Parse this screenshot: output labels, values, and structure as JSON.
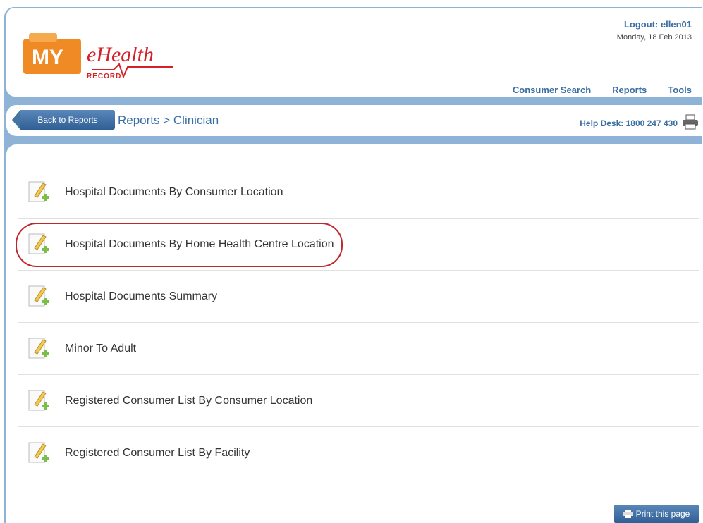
{
  "colors": {
    "accent": "#3a6fa3",
    "frame": "#8fb3d6",
    "highlight": "#c0282d",
    "logo_orange": "#f08a24",
    "logo_red": "#d42027"
  },
  "logo": {
    "my": "MY",
    "ehealth": "eHealth",
    "record": "RECORD"
  },
  "header": {
    "logout": "Logout: ellen01",
    "date": "Monday, 18 Feb 2013",
    "nav": [
      "Consumer Search",
      "Reports",
      "Tools"
    ]
  },
  "subbar": {
    "back_label": "Back to Reports",
    "breadcrumb": "Reports > Clinician",
    "helpdesk": "Help Desk: 1800 247 430",
    "print_icon": "printer-icon"
  },
  "reports": [
    {
      "label": "Hospital Documents By Consumer Location",
      "icon": "report-add-icon"
    },
    {
      "label": "Hospital Documents By Home Health Centre Location",
      "icon": "report-add-icon",
      "highlighted": true
    },
    {
      "label": "Hospital Documents Summary",
      "icon": "report-add-icon"
    },
    {
      "label": "Minor To Adult",
      "icon": "report-add-icon"
    },
    {
      "label": "Registered Consumer List By Consumer Location",
      "icon": "report-add-icon"
    },
    {
      "label": "Registered Consumer List By Facility",
      "icon": "report-add-icon"
    }
  ],
  "footer": {
    "print_label": "Print this page"
  }
}
